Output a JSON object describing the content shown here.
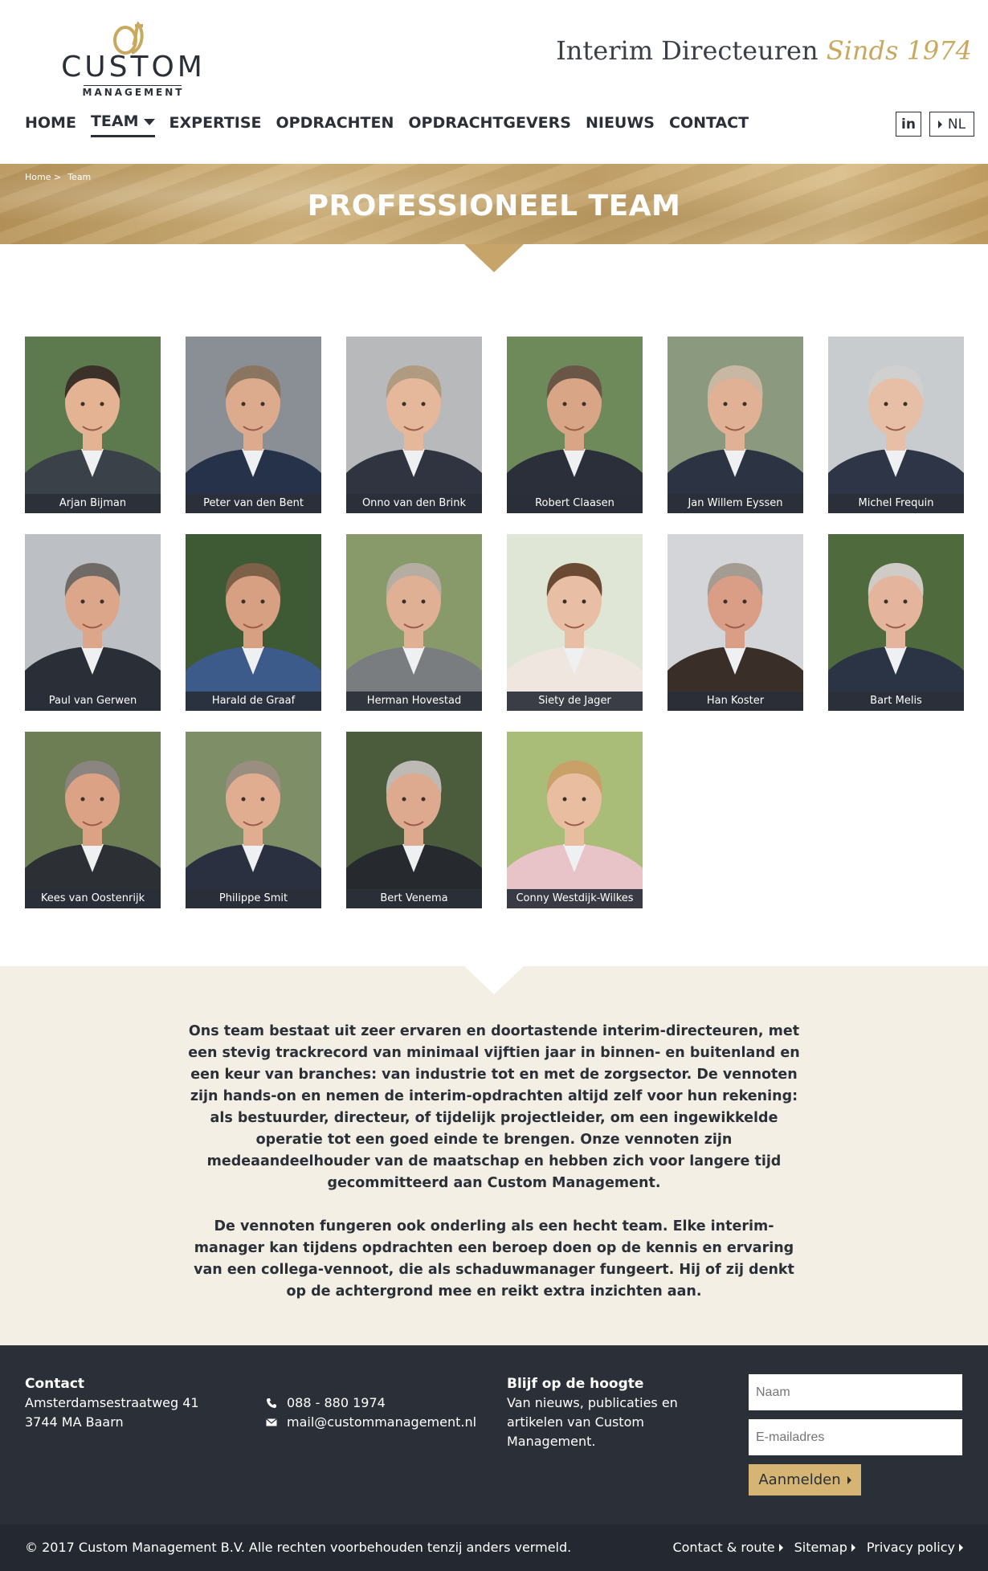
{
  "brand": {
    "logo_name": "CUSTOM",
    "logo_sub": "MANAGEMENT",
    "tagline_part1": "Interim Directeuren",
    "tagline_part2": "Sinds 1974",
    "gold": "#c9a85f",
    "dark": "#2a2f38"
  },
  "nav": {
    "items": [
      {
        "label": "HOME"
      },
      {
        "label": "TEAM"
      },
      {
        "label": "EXPERTISE"
      },
      {
        "label": "OPDRACHTEN"
      },
      {
        "label": "OPDRACHTGEVERS"
      },
      {
        "label": "NIEUWS"
      },
      {
        "label": "CONTACT"
      }
    ],
    "social_label": "in",
    "lang_label": "NL"
  },
  "banner": {
    "breadcrumb_home": "Home >",
    "breadcrumb_current": "Team",
    "title": "PROFESSIONEEL TEAM"
  },
  "team": [
    {
      "name": "Arjan Bijman"
    },
    {
      "name": "Peter van den Bent"
    },
    {
      "name": "Onno van den Brink"
    },
    {
      "name": "Robert Claasen"
    },
    {
      "name": "Jan Willem Eyssen"
    },
    {
      "name": "Michel Frequin"
    },
    {
      "name": "Paul van Gerwen"
    },
    {
      "name": "Harald de Graaf"
    },
    {
      "name": "Herman Hovestad"
    },
    {
      "name": "Siety de Jager"
    },
    {
      "name": "Han Koster"
    },
    {
      "name": "Bart Melis"
    },
    {
      "name": "Kees van Oostenrijk"
    },
    {
      "name": "Philippe Smit"
    },
    {
      "name": "Bert Venema"
    },
    {
      "name": "Conny Westdijk-Wilkes"
    }
  ],
  "intro": {
    "p1": "Ons team bestaat uit zeer ervaren en doortastende interim-directeuren, met een stevig trackrecord van minimaal vijftien jaar in binnen- en buitenland en een keur van branches: van industrie tot en met de zorgsector. De vennoten zijn hands-on en nemen de interim-opdrachten altijd zelf voor hun rekening: als bestuurder, directeur, of tijdelijk projectleider, om een ingewikkelde operatie tot een goed einde te brengen. Onze vennoten zijn medeaandeelhouder van de maatschap en hebben zich voor langere tijd gecommitteerd aan Custom Management.",
    "p2": "De vennoten fungeren ook onderling als een hecht team. Elke interim-manager kan tijdens opdrachten een beroep doen op de kennis en ervaring van een collega-vennoot, die als schaduwmanager fungeert. Hij of zij denkt op de achtergrond mee en reikt extra inzichten aan."
  },
  "footer": {
    "contact_title": "Contact",
    "address1": "Amsterdamsestraatweg 41",
    "address2": "3744 MA Baarn",
    "phone": "088 - 880 1974",
    "email": "mail@custommanagement.nl",
    "news_title": "Blijf op de hoogte",
    "news_text": "Van nieuws, publicaties en artikelen van Custom Management.",
    "name_placeholder": "Naam",
    "email_placeholder": "E-mailadres",
    "submit_label": "Aanmelden",
    "copyright": "© 2017 Custom Management B.V. Alle rechten voorbehouden tenzij anders vermeld.",
    "links": [
      {
        "label": "Contact & route"
      },
      {
        "label": "Sitemap"
      },
      {
        "label": "Privacy policy"
      }
    ]
  }
}
